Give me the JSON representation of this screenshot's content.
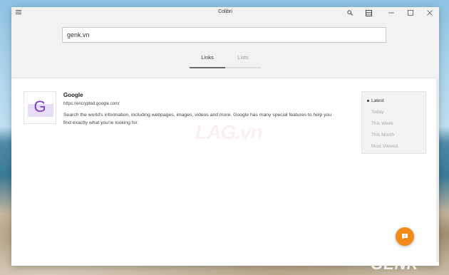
{
  "window": {
    "title": "Colibri"
  },
  "search": {
    "value": "genk.vn"
  },
  "tabs": [
    {
      "label": "Links",
      "active": true
    },
    {
      "label": "Lists",
      "active": false
    }
  ],
  "result": {
    "favicon_letter": "G",
    "title": "Google",
    "url": "https://encrypted.google.com/",
    "description": "Search the world's information, including webpages, images, videos and more. Google has many special features to help you find exactly what you're looking for."
  },
  "filters": [
    {
      "label": "Latest",
      "selected": true
    },
    {
      "label": "Today",
      "selected": false
    },
    {
      "label": "This Week",
      "selected": false
    },
    {
      "label": "This Month",
      "selected": false
    },
    {
      "label": "Most Viewed",
      "selected": false
    }
  ],
  "watermark": {
    "center_text": "LAG.vn",
    "corner_text": "GENK"
  },
  "icons": {
    "menu": "hamburger-icon",
    "search": "search-icon",
    "reading_list": "reading-list-icon",
    "minimize": "minimize-icon",
    "maximize": "maximize-icon",
    "close": "close-icon",
    "feedback": "feedback-icon"
  },
  "colors": {
    "accent": "#f28a1a",
    "favicon": "#7b3fd0"
  }
}
